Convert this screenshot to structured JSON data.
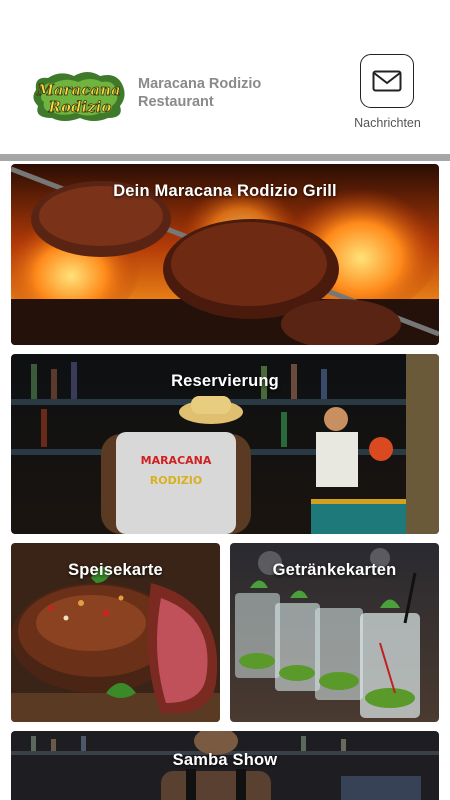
{
  "header": {
    "logo_text_line1": "Maracana",
    "logo_text_line2": "Rodizio",
    "restaurant_name": "Maracana Rodizio Restaurant",
    "messages_label": "Nachrichten"
  },
  "tiles": [
    {
      "title": "Dein Maracana Rodizio Grill"
    },
    {
      "title": "Reservierung",
      "shirt_line1": "MARACANA",
      "shirt_line2": "RODIZIO"
    },
    {
      "title": "Speisekarte"
    },
    {
      "title": "Getränkekarten"
    },
    {
      "title": "Samba Show"
    }
  ],
  "colors": {
    "divider": "#a6a6a6",
    "header_text": "#8a8a8a",
    "tile_title": "#ffffff"
  }
}
